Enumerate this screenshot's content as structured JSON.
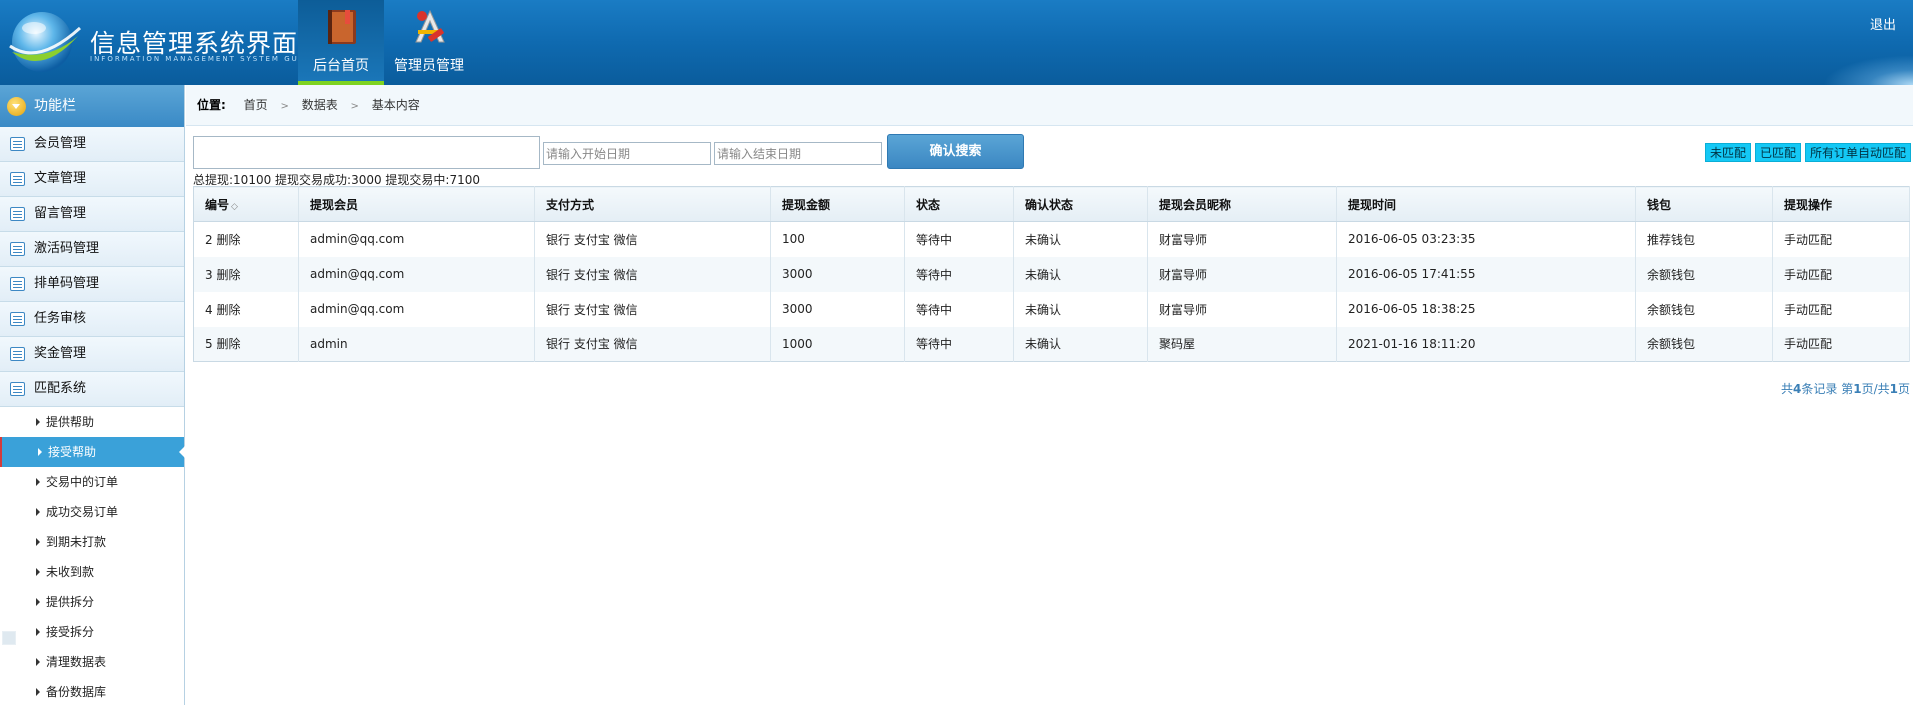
{
  "header": {
    "title": "信息管理系统界面",
    "subtitle": "INFORMATION MANAGEMENT SYSTEM GUI",
    "nav": [
      {
        "label": "后台首页",
        "icon": "book-icon"
      },
      {
        "label": "管理员管理",
        "icon": "tools-icon"
      }
    ],
    "logout": "退出"
  },
  "sidebar": {
    "title": "功能栏",
    "items": [
      {
        "label": "会员管理"
      },
      {
        "label": "文章管理"
      },
      {
        "label": "留言管理"
      },
      {
        "label": "激活码管理"
      },
      {
        "label": "排单码管理"
      },
      {
        "label": "任务审核"
      },
      {
        "label": "奖金管理"
      },
      {
        "label": "匹配系统"
      }
    ],
    "subitems": [
      {
        "label": "提供帮助"
      },
      {
        "label": "接受帮助"
      },
      {
        "label": "交易中的订单"
      },
      {
        "label": "成功交易订单"
      },
      {
        "label": "到期未打款"
      },
      {
        "label": "未收到款"
      },
      {
        "label": "提供拆分"
      },
      {
        "label": "接受拆分"
      },
      {
        "label": "清理数据表"
      },
      {
        "label": "备份数据库"
      }
    ]
  },
  "breadcrumb": {
    "label": "位置:",
    "items": [
      "首页",
      "数据表",
      "基本内容"
    ]
  },
  "search": {
    "main_value": "",
    "start_placeholder": "请输入开始日期",
    "end_placeholder": "请输入结束日期",
    "button": "确认搜索"
  },
  "stats": "总提现:10100 提现交易成功:3000 提现交易中:7100",
  "actions": [
    "未匹配",
    "已匹配",
    "所有订单自动匹配"
  ],
  "table": {
    "columns": [
      "编号",
      "提现会员",
      "支付方式",
      "提现金额",
      "状态",
      "确认状态",
      "提现会员昵称",
      "提现时间",
      "钱包",
      "提现操作"
    ],
    "sort_icon": "◇",
    "rows": [
      [
        "2 删除",
        "admin@qq.com",
        "银行 支付宝 微信",
        "100",
        "等待中",
        "未确认",
        "财富导师",
        "2016-06-05 03:23:35",
        "推荐钱包",
        "手动匹配"
      ],
      [
        "3 删除",
        "admin@qq.com",
        "银行 支付宝 微信",
        "3000",
        "等待中",
        "未确认",
        "财富导师",
        "2016-06-05 17:41:55",
        "余额钱包",
        "手动匹配"
      ],
      [
        "4 删除",
        "admin@qq.com",
        "银行 支付宝 微信",
        "3000",
        "等待中",
        "未确认",
        "财富导师",
        "2016-06-05 18:38:25",
        "余额钱包",
        "手动匹配"
      ],
      [
        "5 删除",
        "admin",
        "银行 支付宝 微信",
        "1000",
        "等待中",
        "未确认",
        "聚码屋",
        "2021-01-16 18:11:20",
        "余额钱包",
        "手动匹配"
      ]
    ]
  },
  "pager": {
    "prefix": "共",
    "total": "4",
    "mid1": "条记录 第",
    "page": "1",
    "mid2": "页/共",
    "pages": "1",
    "suffix": "页"
  }
}
